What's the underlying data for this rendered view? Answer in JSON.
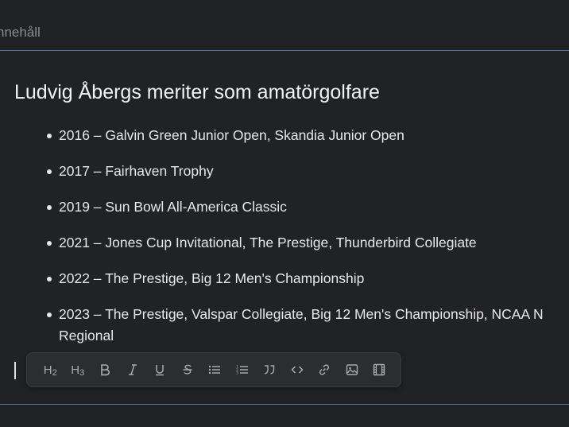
{
  "header": {
    "label": "nnehåll"
  },
  "document": {
    "heading": "Ludvig Åbergs meriter som amatörgolfare",
    "items": [
      {
        "text": "2016 – Galvin Green Junior Open, Skandia Junior Open"
      },
      {
        "text": "2017 – Fairhaven Trophy"
      },
      {
        "text": "2019 – Sun Bowl All-America Classic"
      },
      {
        "text": "2021 – Jones Cup Invitational, The Prestige, Thunderbird Collegiate"
      },
      {
        "text": "2022 – The Prestige, Big 12 Men's Championship"
      },
      {
        "text": "2023 – The Prestige, Valspar Collegiate, Big 12 Men's Championship, NCAA N",
        "text2": "Regional"
      }
    ]
  },
  "toolbar": {
    "buttons": [
      {
        "icon": "heading-2-icon",
        "label": "H",
        "sub": "2"
      },
      {
        "icon": "heading-3-icon",
        "label": "H",
        "sub": "3"
      },
      {
        "icon": "bold-icon"
      },
      {
        "icon": "italic-icon"
      },
      {
        "icon": "underline-icon"
      },
      {
        "icon": "strikethrough-icon"
      },
      {
        "icon": "bullet-list-icon"
      },
      {
        "icon": "numbered-list-icon"
      },
      {
        "icon": "quote-icon"
      },
      {
        "icon": "code-icon"
      },
      {
        "icon": "link-icon"
      },
      {
        "icon": "image-icon"
      },
      {
        "icon": "video-icon"
      }
    ]
  },
  "colors": {
    "background": "#212226",
    "divider": "#5a6fa6",
    "toolbar_bg": "#2c2d31",
    "text": "#ececec",
    "muted": "#8a8b8f"
  }
}
